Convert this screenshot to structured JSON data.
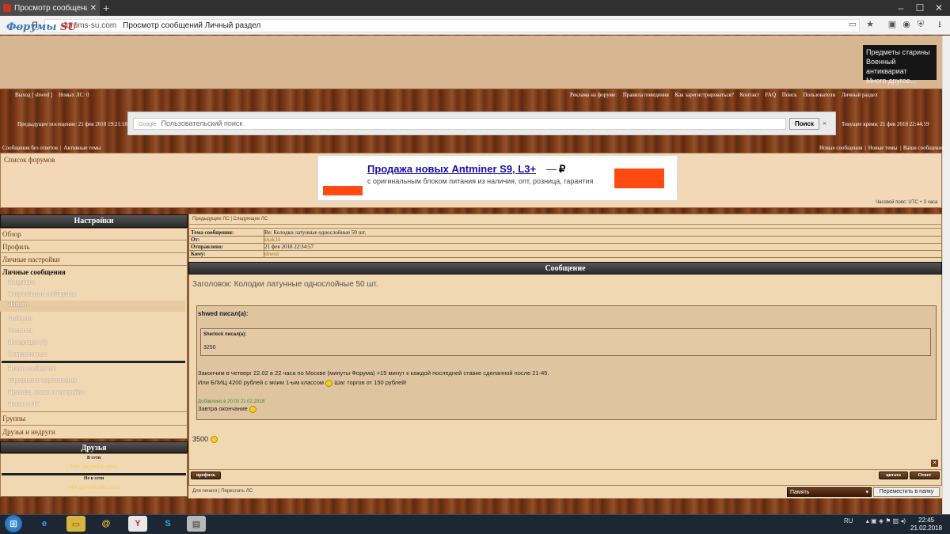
{
  "browser": {
    "tab_title": "Просмотр сообщений Л",
    "url_host": "forums-su.com",
    "url_page_title": "Просмотр сообщений Личный раздел",
    "yandex_label": "Я"
  },
  "header": {
    "logo_main": "Форумы",
    "logo_accent": "SU",
    "promo_lines": [
      "Предметы старины",
      "Военный антиквариат",
      "Много другое..."
    ]
  },
  "topnav": {
    "left": [
      "Выход [ shwed ]",
      "Новых ЛС: 0"
    ],
    "right": [
      "Реклама на форуме:",
      "Правила поведения",
      "Как зарегистрироваться?",
      "Контакт",
      "FAQ",
      "Поиск",
      "Пользователи",
      "Личный раздел"
    ]
  },
  "search": {
    "last_visit": "Предыдущее посещение: 21 фев 2018 19:21:18",
    "google_label": "Google",
    "placeholder": "Пользовательский поиск",
    "button": "Поиск",
    "clear": "×",
    "current_time": "Текущее время: 21 фев 2018 22:44:59"
  },
  "subnav": {
    "left": [
      "Сообщения без ответов",
      "Активные темы"
    ],
    "right": [
      "Новые сообщения",
      "Новые темы",
      "Ваши сообщения"
    ]
  },
  "forum_list": {
    "title": "Список форумов",
    "timezone": "Часовой пояс: UTC + 3 часа"
  },
  "ad": {
    "title": "Продажа новых Antminer S9, L3+",
    "dash": "—",
    "rub": "₽",
    "text": "с оригинальным блоком питания из наличия, опт, розница, гарантия"
  },
  "sidebar": {
    "header": "Настройки",
    "categories": [
      "Обзор",
      "Профиль",
      "Личные настройки"
    ],
    "pm_title": "Личные сообщения",
    "pm_items": [
      "Входящие",
      "Сохранённые сообщения",
      "Память",
      "Фаберже",
      "Запасная",
      "Исходящие (4)",
      "Отправленные"
    ],
    "pm_actions": [
      "Новое сообщение",
      "Управление черновиками",
      "Правила, папки и настройки",
      "Поиск в ЛС"
    ],
    "groups": "Группы",
    "friends_foes": "Друзья и недруги",
    "friends_header": "Друзья",
    "online": "В сети",
    "online_text": "Нет друзей в сети",
    "offline": "Не в сети",
    "offline_text": "Нет друзей вне сети"
  },
  "message": {
    "nav": "Предыдущее ЛС | Следующее ЛС",
    "subject_label": "Тема сообщения:",
    "subject_value": "Re: Колодки латунные однослойные 50 шт.",
    "from_label": "От:",
    "from_value": "snak34",
    "sent_label": "Отправлено:",
    "sent_value": "21 фев 2018 22:34:57",
    "to_label": "Кому:",
    "to_value": "shwed",
    "section_title": "Сообщение",
    "heading": "Заголовок: Колодки латунные однослойные 50 шт.",
    "quote_author": "shwed писал(а):",
    "inner_quote_author": "Sherlock писал(а):",
    "inner_quote_value": "3250",
    "line1": "Закончим в четверг 22.02 в 22 часа по Москве (минуты Форума) +15 минут к каждой последней ставке сделанной после 21-45.",
    "line2a": "Или БЛИЦ 4200 рублей с моим 1-ым классом",
    "line2b": "Шаг торгов от 150 рублей!",
    "added": "Добавлено в 20:00 21.02.2018:",
    "end_line": "Завтра окончание",
    "reply_value": "3500",
    "profile_btn": "профиль",
    "quote_btn": "цитата",
    "reply_btn": "Ответ",
    "bottom_links": "Для печати | Переслать ЛС",
    "folder_selected": "Память",
    "move_btn": "Переместить в папку"
  },
  "taskbar": {
    "lang": "RU",
    "time": "22:45",
    "date": "21.02.2018"
  }
}
